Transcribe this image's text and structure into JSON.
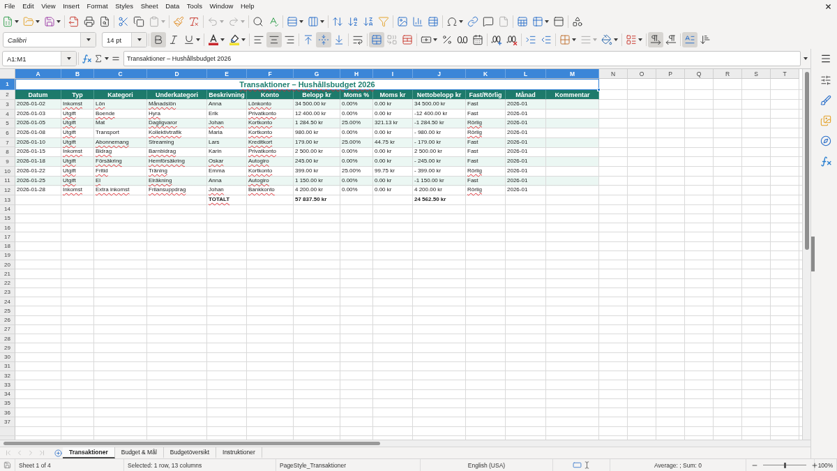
{
  "menu_bar": {
    "items": [
      "File",
      "Edit",
      "View",
      "Insert",
      "Format",
      "Styles",
      "Sheet",
      "Data",
      "Tools",
      "Window",
      "Help"
    ]
  },
  "standard_toolbar": [
    {
      "kind": "new",
      "disabled": false
    },
    {
      "kind": "open",
      "disabled": false
    },
    {
      "kind": "save",
      "disabled": false
    },
    {
      "kind": "export_pdf",
      "disabled": false
    },
    {
      "kind": "print",
      "disabled": false
    },
    {
      "kind": "print_preview",
      "disabled": false
    },
    {
      "kind": "cut",
      "disabled": false
    },
    {
      "kind": "copy",
      "disabled": false
    },
    {
      "kind": "paste",
      "disabled": true
    },
    {
      "kind": "clone_formatting",
      "disabled": false
    },
    {
      "kind": "clear_formatting",
      "disabled": false
    },
    {
      "kind": "undo",
      "disabled": true
    },
    {
      "kind": "redo",
      "disabled": true
    },
    {
      "kind": "find_replace",
      "disabled": false
    },
    {
      "kind": "spelling",
      "disabled": false
    },
    {
      "kind": "row",
      "disabled": false
    },
    {
      "kind": "column",
      "disabled": false
    },
    {
      "kind": "sort",
      "disabled": false
    },
    {
      "kind": "sort_ascending",
      "disabled": false
    },
    {
      "kind": "sort_descending",
      "disabled": false
    },
    {
      "kind": "autofilter",
      "disabled": false
    },
    {
      "kind": "image",
      "disabled": false
    },
    {
      "kind": "chart",
      "disabled": false
    },
    {
      "kind": "pivot_table",
      "disabled": false
    },
    {
      "kind": "special_character",
      "disabled": false
    },
    {
      "kind": "hyperlink",
      "disabled": false
    },
    {
      "kind": "comment",
      "disabled": false
    },
    {
      "kind": "header_footer",
      "disabled": true
    },
    {
      "kind": "print_area",
      "disabled": false
    },
    {
      "kind": "freeze_rows",
      "disabled": false
    },
    {
      "kind": "split_window",
      "disabled": false
    },
    {
      "kind": "shapes",
      "disabled": false
    }
  ],
  "format_toolbar": {
    "font_name": "Calibri",
    "font_size": "14 pt",
    "buttons": [
      {
        "kind": "bold",
        "pressed": true,
        "disabled": false
      },
      {
        "kind": "italic",
        "pressed": false,
        "disabled": false
      },
      {
        "kind": "underline",
        "pressed": false,
        "disabled": false
      },
      {
        "kind": "font_color",
        "pressed": false,
        "disabled": false
      },
      {
        "kind": "highlight",
        "pressed": false,
        "disabled": false
      },
      {
        "kind": "align_left",
        "pressed": false,
        "disabled": false
      },
      {
        "kind": "align_center",
        "pressed": true,
        "disabled": false
      },
      {
        "kind": "align_right",
        "pressed": false,
        "disabled": false
      },
      {
        "kind": "align_top",
        "pressed": false,
        "disabled": false
      },
      {
        "kind": "align_middle",
        "pressed": true,
        "disabled": false
      },
      {
        "kind": "align_bottom",
        "pressed": false,
        "disabled": false
      },
      {
        "kind": "wrap_text",
        "pressed": false,
        "disabled": false
      },
      {
        "kind": "merge_center",
        "pressed": true,
        "disabled": false
      },
      {
        "kind": "merge_cells",
        "pressed": false,
        "disabled": true
      },
      {
        "kind": "unmerge_cells",
        "pressed": false,
        "disabled": false
      },
      {
        "kind": "currency_format",
        "pressed": false,
        "disabled": false
      },
      {
        "kind": "percent_format",
        "pressed": false,
        "disabled": false
      },
      {
        "kind": "standard_format",
        "pressed": false,
        "disabled": false
      },
      {
        "kind": "date_format",
        "pressed": false,
        "disabled": false
      },
      {
        "kind": "add_decimal",
        "pressed": false,
        "disabled": false
      },
      {
        "kind": "delete_decimal",
        "pressed": false,
        "disabled": false
      },
      {
        "kind": "increase_indent",
        "pressed": false,
        "disabled": false
      },
      {
        "kind": "decrease_indent",
        "pressed": false,
        "disabled": false
      },
      {
        "kind": "borders",
        "pressed": false,
        "disabled": false
      },
      {
        "kind": "border_style",
        "pressed": false,
        "disabled": true
      },
      {
        "kind": "border_color",
        "pressed": false,
        "disabled": false
      },
      {
        "kind": "conditional_format",
        "pressed": false,
        "disabled": false
      },
      {
        "kind": "paragraph_ltr",
        "pressed": true,
        "disabled": false
      },
      {
        "kind": "paragraph_rtl",
        "pressed": false,
        "disabled": false
      },
      {
        "kind": "text_ltr",
        "pressed": true,
        "disabled": false
      },
      {
        "kind": "text_vertical",
        "pressed": false,
        "disabled": false
      }
    ]
  },
  "formula_bar": {
    "name_box": "A1:M1",
    "content": "Transaktioner – Hushållsbudget 2026"
  },
  "sheet": {
    "columns": [
      {
        "label": "A",
        "selected": true
      },
      {
        "label": "B",
        "selected": true
      },
      {
        "label": "C",
        "selected": true
      },
      {
        "label": "D",
        "selected": true
      },
      {
        "label": "E",
        "selected": true
      },
      {
        "label": "F",
        "selected": true
      },
      {
        "label": "G",
        "selected": true
      },
      {
        "label": "H",
        "selected": true
      },
      {
        "label": "I",
        "selected": true
      },
      {
        "label": "J",
        "selected": true
      },
      {
        "label": "K",
        "selected": true
      },
      {
        "label": "L",
        "selected": true
      },
      {
        "label": "M",
        "selected": true
      },
      {
        "label": "N",
        "selected": false
      },
      {
        "label": "O",
        "selected": false
      },
      {
        "label": "P",
        "selected": false
      },
      {
        "label": "Q",
        "selected": false
      },
      {
        "label": "R",
        "selected": false
      },
      {
        "label": "S",
        "selected": false
      },
      {
        "label": "T",
        "selected": false
      }
    ],
    "rows": [
      {
        "label": "1",
        "selected": true
      },
      {
        "label": "2",
        "selected": false
      },
      {
        "label": "3",
        "selected": false
      },
      {
        "label": "4",
        "selected": false
      },
      {
        "label": "5",
        "selected": false
      },
      {
        "label": "6",
        "selected": false
      },
      {
        "label": "7",
        "selected": false
      },
      {
        "label": "8",
        "selected": false
      },
      {
        "label": "9",
        "selected": false
      },
      {
        "label": "10",
        "selected": false
      },
      {
        "label": "11",
        "selected": false
      },
      {
        "label": "12",
        "selected": false
      },
      {
        "label": "13",
        "selected": false
      },
      {
        "label": "14",
        "selected": false
      },
      {
        "label": "15",
        "selected": false
      },
      {
        "label": "16",
        "selected": false
      },
      {
        "label": "17",
        "selected": false
      },
      {
        "label": "18",
        "selected": false
      },
      {
        "label": "19",
        "selected": false
      },
      {
        "label": "20",
        "selected": false
      },
      {
        "label": "21",
        "selected": false
      },
      {
        "label": "22",
        "selected": false
      },
      {
        "label": "23",
        "selected": false
      },
      {
        "label": "24",
        "selected": false
      },
      {
        "label": "25",
        "selected": false
      },
      {
        "label": "26",
        "selected": false
      },
      {
        "label": "27",
        "selected": false
      },
      {
        "label": "28",
        "selected": false
      },
      {
        "label": "29",
        "selected": false
      },
      {
        "label": "30",
        "selected": false
      },
      {
        "label": "31",
        "selected": false
      },
      {
        "label": "32",
        "selected": false
      },
      {
        "label": "33",
        "selected": false
      },
      {
        "label": "34",
        "selected": false
      },
      {
        "label": "35",
        "selected": false
      },
      {
        "label": "36",
        "selected": false
      },
      {
        "label": "37",
        "selected": false
      }
    ],
    "title": {
      "text": "Transaktioner – Hushållsbudget 2026",
      "selected": true,
      "misspelled": true
    },
    "header_row": [
      "Datum",
      "Typ",
      "Kategori",
      "Underkategori",
      "Beskrivning",
      "Konto",
      "Belopp kr",
      "Moms %",
      "Moms kr",
      "Nettobelopp kr",
      "Fast/Rörlig",
      "Månad",
      "Kommentar"
    ],
    "data_rows": [
      {
        "cells": [
          {
            "text": "2026-01-02",
            "misspelled": false
          },
          {
            "text": "Inkomst",
            "misspelled": true
          },
          {
            "text": "Lön",
            "misspelled": true
          },
          {
            "text": "Månadslön",
            "misspelled": true
          },
          {
            "text": "Anna",
            "misspelled": false
          },
          {
            "text": "Lönkonto",
            "misspelled": true
          },
          {
            "text": "34 500.00 kr",
            "misspelled": false
          },
          {
            "text": "0.00%",
            "misspelled": false
          },
          {
            "text": "0.00 kr",
            "misspelled": false
          },
          {
            "text": "34 500.00 kr",
            "misspelled": false
          },
          {
            "text": "Fast",
            "misspelled": false
          },
          {
            "text": "2026-01",
            "misspelled": false
          }
        ]
      },
      {
        "cells": [
          {
            "text": "2026-01-03",
            "misspelled": false
          },
          {
            "text": "Utgift",
            "misspelled": true
          },
          {
            "text": "Boende",
            "misspelled": true
          },
          {
            "text": "Hyra",
            "misspelled": true
          },
          {
            "text": "Erik",
            "misspelled": false
          },
          {
            "text": "Privatkonto",
            "misspelled": true
          },
          {
            "text": "12 400.00 kr",
            "misspelled": false
          },
          {
            "text": "0.00%",
            "misspelled": false
          },
          {
            "text": "0.00 kr",
            "misspelled": false
          },
          {
            "text": "-12 400.00 kr",
            "misspelled": false
          },
          {
            "text": "Fast",
            "misspelled": false
          },
          {
            "text": "2026-01",
            "misspelled": false
          }
        ]
      },
      {
        "cells": [
          {
            "text": "2026-01-05",
            "misspelled": false
          },
          {
            "text": "Utgift",
            "misspelled": true
          },
          {
            "text": "Mat",
            "misspelled": false
          },
          {
            "text": "Dagligvaror",
            "misspelled": true
          },
          {
            "text": "Johan",
            "misspelled": true
          },
          {
            "text": "Kortkonto",
            "misspelled": true
          },
          {
            "text": "1 284.50 kr",
            "misspelled": false
          },
          {
            "text": "25.00%",
            "misspelled": false
          },
          {
            "text": "321.13 kr",
            "misspelled": false
          },
          {
            "text": "-1 284.50 kr",
            "misspelled": false
          },
          {
            "text": "Rörlig",
            "misspelled": true
          },
          {
            "text": "2026-01",
            "misspelled": false
          }
        ]
      },
      {
        "cells": [
          {
            "text": "2026-01-08",
            "misspelled": false
          },
          {
            "text": "Utgift",
            "misspelled": true
          },
          {
            "text": "Transport",
            "misspelled": false
          },
          {
            "text": "Kollektivtrafik",
            "misspelled": true
          },
          {
            "text": "Maria",
            "misspelled": false
          },
          {
            "text": "Kortkonto",
            "misspelled": true
          },
          {
            "text": "980.00 kr",
            "misspelled": false
          },
          {
            "text": "0.00%",
            "misspelled": false
          },
          {
            "text": "0.00 kr",
            "misspelled": false
          },
          {
            "text": "- 980.00 kr",
            "misspelled": false
          },
          {
            "text": "Rörlig",
            "misspelled": true
          },
          {
            "text": "2026-01",
            "misspelled": false
          }
        ]
      },
      {
        "cells": [
          {
            "text": "2026-01-10",
            "misspelled": false
          },
          {
            "text": "Utgift",
            "misspelled": true
          },
          {
            "text": "Abonnemang",
            "misspelled": true
          },
          {
            "text": "Streaming",
            "misspelled": false
          },
          {
            "text": "Lars",
            "misspelled": false
          },
          {
            "text": "Kreditkort",
            "misspelled": true
          },
          {
            "text": "179.00 kr",
            "misspelled": false
          },
          {
            "text": "25.00%",
            "misspelled": false
          },
          {
            "text": "44.75 kr",
            "misspelled": false
          },
          {
            "text": "- 179.00 kr",
            "misspelled": false
          },
          {
            "text": "Fast",
            "misspelled": false
          },
          {
            "text": "2026-01",
            "misspelled": false
          }
        ]
      },
      {
        "cells": [
          {
            "text": "2026-01-15",
            "misspelled": false
          },
          {
            "text": "Inkomst",
            "misspelled": true
          },
          {
            "text": "Bidrag",
            "misspelled": true
          },
          {
            "text": "Barnbidrag",
            "misspelled": true
          },
          {
            "text": "Karin",
            "misspelled": false
          },
          {
            "text": "Privatkonto",
            "misspelled": true
          },
          {
            "text": "2 500.00 kr",
            "misspelled": false
          },
          {
            "text": "0.00%",
            "misspelled": false
          },
          {
            "text": "0.00 kr",
            "misspelled": false
          },
          {
            "text": "2 500.00 kr",
            "misspelled": false
          },
          {
            "text": "Fast",
            "misspelled": false
          },
          {
            "text": "2026-01",
            "misspelled": false
          }
        ]
      },
      {
        "cells": [
          {
            "text": "2026-01-18",
            "misspelled": false
          },
          {
            "text": "Utgift",
            "misspelled": true
          },
          {
            "text": "Försäkring",
            "misspelled": true
          },
          {
            "text": "Hemförsäkring",
            "misspelled": true
          },
          {
            "text": "Oskar",
            "misspelled": true
          },
          {
            "text": "Autogiro",
            "misspelled": true
          },
          {
            "text": "245.00 kr",
            "misspelled": false
          },
          {
            "text": "0.00%",
            "misspelled": false
          },
          {
            "text": "0.00 kr",
            "misspelled": false
          },
          {
            "text": "- 245.00 kr",
            "misspelled": false
          },
          {
            "text": "Fast",
            "misspelled": false
          },
          {
            "text": "2026-01",
            "misspelled": false
          }
        ]
      },
      {
        "cells": [
          {
            "text": "2026-01-22",
            "misspelled": false
          },
          {
            "text": "Utgift",
            "misspelled": true
          },
          {
            "text": "Fritid",
            "misspelled": true
          },
          {
            "text": "Träning",
            "misspelled": true
          },
          {
            "text": "Emma",
            "misspelled": false
          },
          {
            "text": "Kortkonto",
            "misspelled": true
          },
          {
            "text": "399.00 kr",
            "misspelled": false
          },
          {
            "text": "25.00%",
            "misspelled": false
          },
          {
            "text": "99.75 kr",
            "misspelled": false
          },
          {
            "text": "- 399.00 kr",
            "misspelled": false
          },
          {
            "text": "Rörlig",
            "misspelled": true
          },
          {
            "text": "2026-01",
            "misspelled": false
          }
        ]
      },
      {
        "cells": [
          {
            "text": "2026-01-25",
            "misspelled": false
          },
          {
            "text": "Utgift",
            "misspelled": true
          },
          {
            "text": "El",
            "misspelled": true
          },
          {
            "text": "Elräkning",
            "misspelled": true
          },
          {
            "text": "Anna",
            "misspelled": false
          },
          {
            "text": "Autogiro",
            "misspelled": true
          },
          {
            "text": "1 150.00 kr",
            "misspelled": false
          },
          {
            "text": "0.00%",
            "misspelled": false
          },
          {
            "text": "0.00 kr",
            "misspelled": false
          },
          {
            "text": "-1 150.00 kr",
            "misspelled": false
          },
          {
            "text": "Fast",
            "misspelled": false
          },
          {
            "text": "2026-01",
            "misspelled": false
          }
        ]
      },
      {
        "cells": [
          {
            "text": "2026-01-28",
            "misspelled": false
          },
          {
            "text": "Inkomst",
            "misspelled": true
          },
          {
            "text": "Extra inkomst",
            "misspelled": true
          },
          {
            "text": "Frilansuppdrag",
            "misspelled": true
          },
          {
            "text": "Johan",
            "misspelled": true
          },
          {
            "text": "Bankkonto",
            "misspelled": true
          },
          {
            "text": "4 200.00 kr",
            "misspelled": false
          },
          {
            "text": "0.00%",
            "misspelled": false
          },
          {
            "text": "0.00 kr",
            "misspelled": false
          },
          {
            "text": "4 200.00 kr",
            "misspelled": false
          },
          {
            "text": "Rörlig",
            "misspelled": true
          },
          {
            "text": "2026-01",
            "misspelled": false
          }
        ]
      }
    ],
    "totals_row": {
      "label": {
        "text": "TOTALT",
        "misspelled": true
      },
      "amount": "57 837.50 kr",
      "net_amount": "24 562.50 kr"
    }
  },
  "sheet_navigation": [
    {
      "kind": "first",
      "disabled": true
    },
    {
      "kind": "previous",
      "disabled": true
    },
    {
      "kind": "next",
      "disabled": true
    },
    {
      "kind": "last",
      "disabled": true
    }
  ],
  "sheet_tabs": [
    {
      "label": "Transaktioner",
      "selected": true
    },
    {
      "label": "Budget & Mål",
      "selected": false
    },
    {
      "label": "Budgetöversikt",
      "selected": false
    },
    {
      "label": "Instruktioner",
      "selected": false
    }
  ],
  "status_bar": {
    "sheet": "Sheet 1 of 4",
    "selection": "Selected: 1 row, 13 columns",
    "page_style": "PageStyle_Transaktioner",
    "language": "English (USA)",
    "summary": "Average: ; Sum: 0",
    "zoom": {
      "level": 0.5,
      "reading": "100%"
    }
  }
}
